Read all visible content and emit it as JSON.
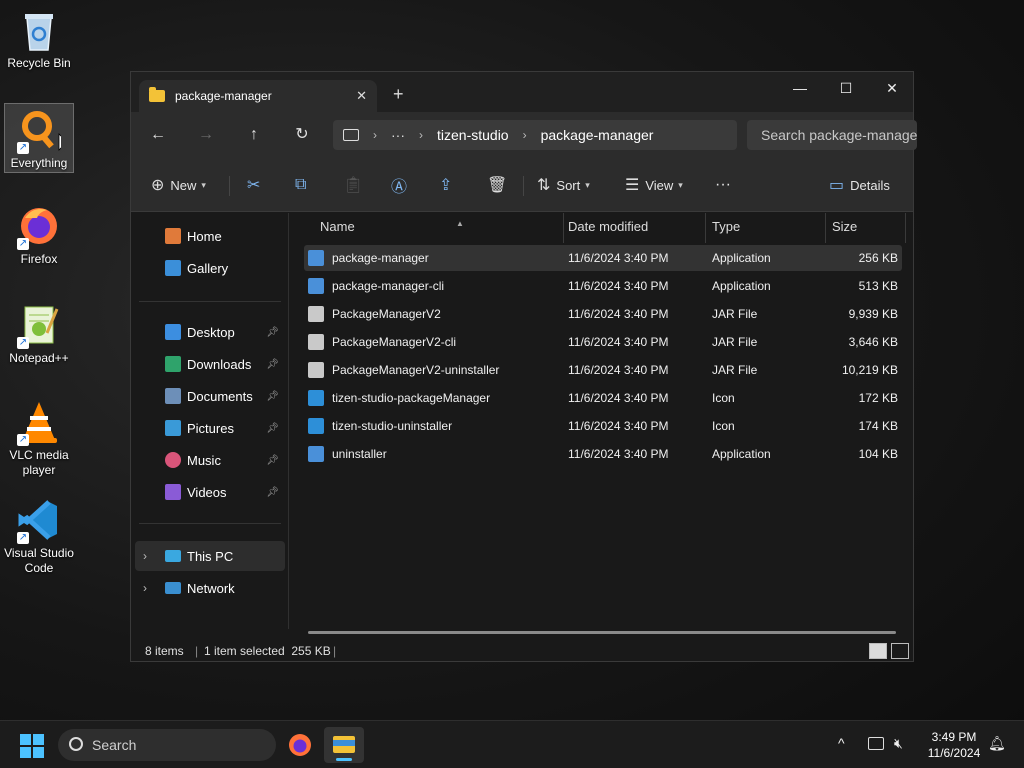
{
  "desktop": {
    "icons": [
      {
        "label": "Recycle Bin",
        "icon": "recycle-bin-icon"
      },
      {
        "label": "Everything",
        "icon": "everything-search-icon"
      },
      {
        "label": "Firefox",
        "icon": "firefox-icon"
      },
      {
        "label": "Notepad++",
        "icon": "notepadpp-icon"
      },
      {
        "label": "VLC media player",
        "icon": "vlc-icon"
      },
      {
        "label": "Visual Studio Code",
        "icon": "vscode-icon"
      }
    ]
  },
  "window": {
    "tab_title": "package-manager",
    "tab_close": "✕",
    "new_tab": "+",
    "controls": {
      "minimize": "—",
      "maximize": "☐",
      "close": "✕"
    },
    "nav": {
      "back": "←",
      "forward": "→",
      "up": "↑",
      "refresh": "↻"
    },
    "address": {
      "ellipsis": "···",
      "crumbs": [
        "tizen-studio",
        "package-manager"
      ],
      "sep": "›"
    },
    "search_placeholder": "Search package-manager",
    "toolbar": {
      "new_label": "New",
      "sort_label": "Sort",
      "view_label": "View",
      "more": "···",
      "details_label": "Details"
    },
    "sidebar": {
      "items": [
        {
          "label": "Home",
          "pinned": false
        },
        {
          "label": "Gallery",
          "pinned": false
        },
        {
          "label": "Desktop",
          "pinned": true
        },
        {
          "label": "Downloads",
          "pinned": true
        },
        {
          "label": "Documents",
          "pinned": true
        },
        {
          "label": "Pictures",
          "pinned": true
        },
        {
          "label": "Music",
          "pinned": true
        },
        {
          "label": "Videos",
          "pinned": true
        },
        {
          "label": "This PC",
          "pinned": false
        },
        {
          "label": "Network",
          "pinned": false
        }
      ]
    },
    "columns": [
      "Name",
      "Date modified",
      "Type",
      "Size"
    ],
    "files": [
      {
        "name": "package-manager",
        "date": "11/6/2024 3:40 PM",
        "type": "Application",
        "size": "256 KB",
        "icon": "app-icon",
        "selected": true
      },
      {
        "name": "package-manager-cli",
        "date": "11/6/2024 3:40 PM",
        "type": "Application",
        "size": "513 KB",
        "icon": "app-icon",
        "selected": false
      },
      {
        "name": "PackageManagerV2",
        "date": "11/6/2024 3:40 PM",
        "type": "JAR File",
        "size": "9,939 KB",
        "icon": "jar-icon",
        "selected": false
      },
      {
        "name": "PackageManagerV2-cli",
        "date": "11/6/2024 3:40 PM",
        "type": "JAR File",
        "size": "3,646 KB",
        "icon": "jar-icon",
        "selected": false
      },
      {
        "name": "PackageManagerV2-uninstaller",
        "date": "11/6/2024 3:40 PM",
        "type": "JAR File",
        "size": "10,219 KB",
        "icon": "jar-icon",
        "selected": false
      },
      {
        "name": "tizen-studio-packageManager",
        "date": "11/6/2024 3:40 PM",
        "type": "Icon",
        "size": "172 KB",
        "icon": "ico-file-icon",
        "selected": false
      },
      {
        "name": "tizen-studio-uninstaller",
        "date": "11/6/2024 3:40 PM",
        "type": "Icon",
        "size": "174 KB",
        "icon": "ico-file-icon",
        "selected": false
      },
      {
        "name": "uninstaller",
        "date": "11/6/2024 3:40 PM",
        "type": "Application",
        "size": "104 KB",
        "icon": "app-icon",
        "selected": false
      }
    ],
    "status": {
      "count": "8 items",
      "selection": "1 item selected  255 KB"
    }
  },
  "taskbar": {
    "search_label": "Search",
    "time": "3:49 PM",
    "date": "11/6/2024",
    "tray_chevron": "^"
  }
}
